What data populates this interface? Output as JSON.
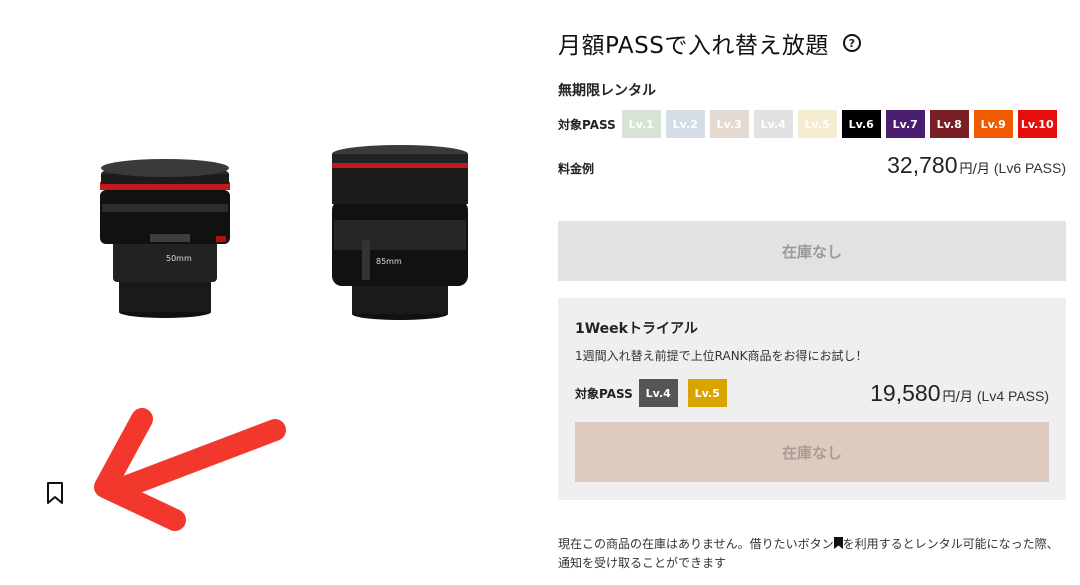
{
  "product": {
    "title": "月額PASSで入れ替え放題",
    "help_icon": "question-circle-icon",
    "help_glyph": "?",
    "lens_label_1": "50mm",
    "lens_label_2": "85mm"
  },
  "unlimited": {
    "section_title": "無期限レンタル",
    "pass_label": "対象PASS",
    "levels": [
      {
        "label": "Lv.1",
        "color": "#d7e3d4"
      },
      {
        "label": "Lv.2",
        "color": "#d4dde6"
      },
      {
        "label": "Lv.3",
        "color": "#e4d9d1"
      },
      {
        "label": "Lv.4",
        "color": "#e1e1e1"
      },
      {
        "label": "Lv.5",
        "color": "#f5ecd2"
      },
      {
        "label": "Lv.6",
        "color": "#000000"
      },
      {
        "label": "Lv.7",
        "color": "#4b1d6e"
      },
      {
        "label": "Lv.8",
        "color": "#7a1f23"
      },
      {
        "label": "Lv.9",
        "color": "#f05a00"
      },
      {
        "label": "Lv.10",
        "color": "#e60d0d"
      }
    ],
    "price_label": "料金例",
    "price": "32,780",
    "price_unit": "円/月",
    "price_note": "(Lv6 PASS)",
    "stock_button": "在庫なし"
  },
  "trial": {
    "title": "1Weekトライアル",
    "description": "1週間入れ替え前提で上位RANK商品をお得にお試し！",
    "pass_label": "対象PASS",
    "levels": [
      {
        "label": "Lv.4",
        "color": "#555555"
      },
      {
        "label": "Lv.5",
        "color": "#d9a300"
      }
    ],
    "price": "19,580",
    "price_unit": "円/月",
    "price_note": "(Lv4 PASS)",
    "stock_button": "在庫なし"
  },
  "notice": {
    "text_before": "現在この商品の在庫はありません。借りたいボタン",
    "text_after": "を利用するとレンタル可能になった際、通知を受け取ることができます",
    "icon": "bookmark-icon"
  },
  "bookmark": {
    "icon": "bookmark-outline-icon"
  },
  "annotation": {
    "icon": "red-arrow-icon",
    "color": "#f2382c"
  }
}
